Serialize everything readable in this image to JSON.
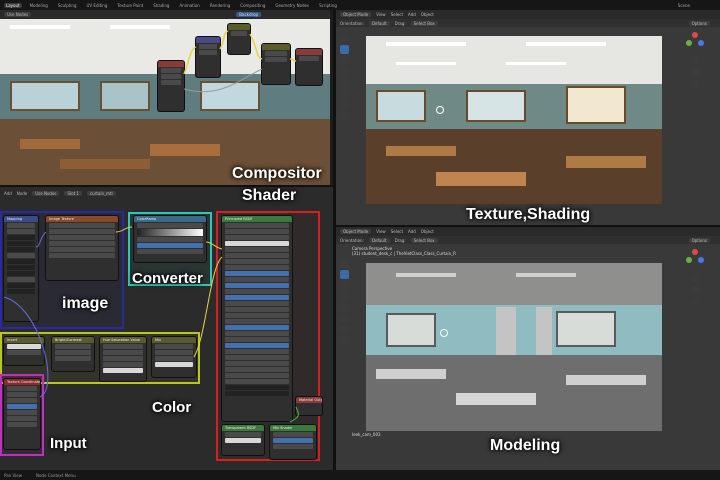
{
  "topbar": {
    "tabs": [
      "Layout",
      "Modeling",
      "Sculpting",
      "UV Editing",
      "Texture Paint",
      "Shading",
      "Animation",
      "Rendering",
      "Compositing",
      "Geometry Nodes",
      "Scripting"
    ],
    "scene": "Scene"
  },
  "compositor": {
    "header_label": "Use Nodes",
    "backdrop_label": "Backdrop",
    "label": "Compositor"
  },
  "shader": {
    "header": [
      "Add",
      "Node",
      "Use Nodes",
      "Slot 1",
      "curtain_mtl"
    ],
    "label": "Shader",
    "nodes": {
      "mapping": "Mapping",
      "image_texture": "Image Texture",
      "color_ramp": "ColorRamp",
      "principled": "Principled BSDF",
      "material_output": "Material Output",
      "texcoord": "Texture Coordinate",
      "transparent": "Transparent BSDF",
      "mix_shader": "Mix Shader",
      "invert": "Invert",
      "brightness": "Bright/Contrast",
      "hue_sat": "Hue Saturation Value",
      "mix": "Mix"
    },
    "group_labels": {
      "image": "image",
      "converter": "Converter",
      "color": "Color",
      "input": "Input"
    }
  },
  "viewport_top": {
    "header": [
      "Object Mode",
      "View",
      "Select",
      "Add",
      "Object"
    ],
    "orientation": "Orientation:",
    "orient_value": "Default",
    "drag": "Drag:",
    "drag_value": "Select Box",
    "options": "Options",
    "label": "Texture,Shading"
  },
  "viewport_bottom": {
    "header": [
      "Object Mode",
      "View",
      "Select",
      "Add",
      "Object"
    ],
    "orientation": "Orientation:",
    "orient_value": "Default",
    "drag": "Drag:",
    "drag_value": "Select Box",
    "options": "Options",
    "camera_text": "Camera Perspective",
    "collection_text": "(31) student_desk_c | TheVietClass_Class_Curtain_R",
    "bottom_text": "leek_cam_003",
    "label": "Modeling"
  },
  "statusbar": {
    "left": "Pan View",
    "middle": "Node Context Menu"
  },
  "colors": {
    "image_frame": "#2a2aa0",
    "converter_frame": "#2fc7b5",
    "shader_frame": "#d42020",
    "color_frame": "#b8c620",
    "input_frame": "#c030c0"
  }
}
